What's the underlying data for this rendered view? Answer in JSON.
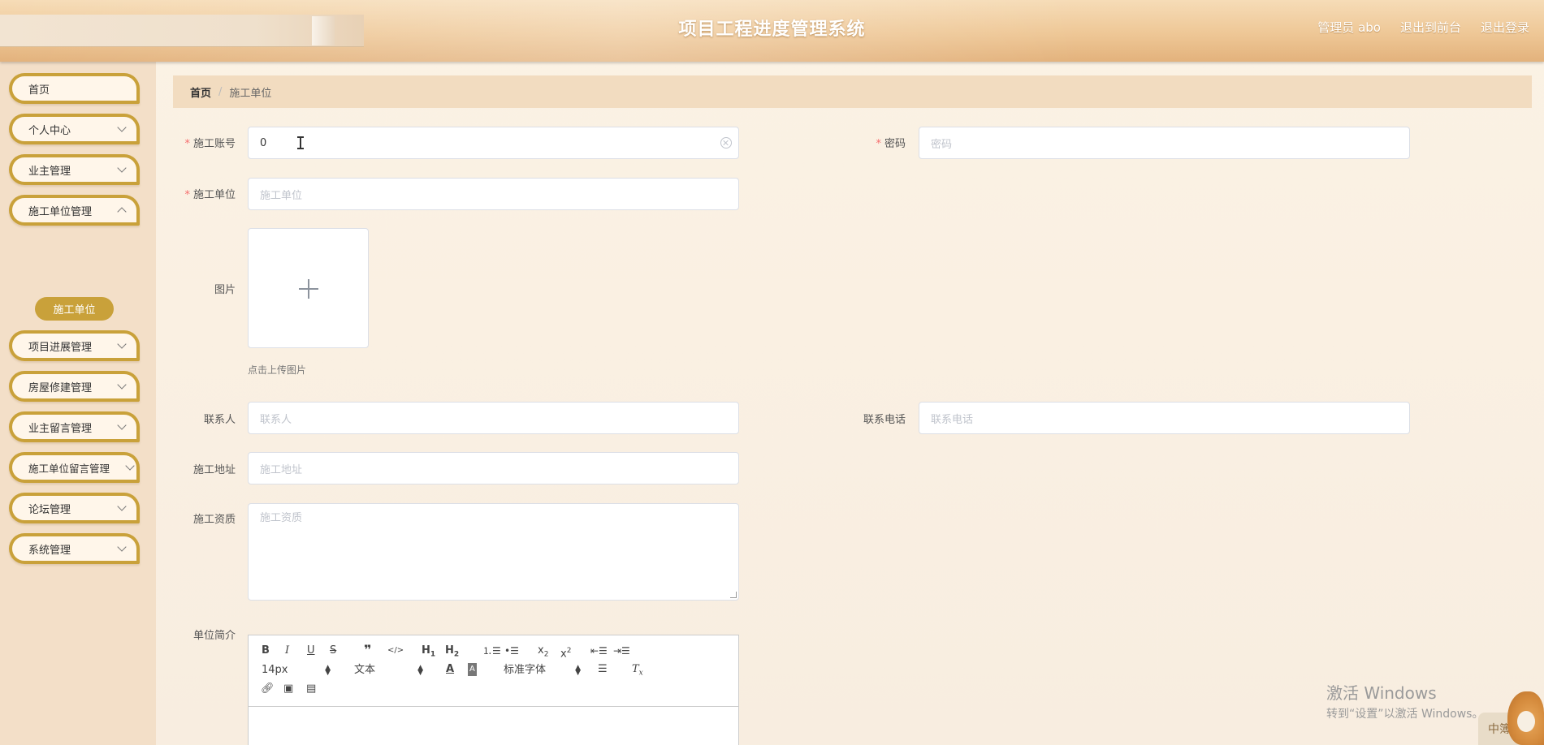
{
  "header": {
    "title": "项目工程进度管理系统",
    "links": [
      "管理员 abo",
      "退出到前台",
      "退出登录"
    ]
  },
  "sidebar": {
    "items": [
      {
        "label": "首页",
        "has_children": false
      },
      {
        "label": "个人中心",
        "has_children": true
      },
      {
        "label": "业主管理",
        "has_children": true
      },
      {
        "label": "施工单位管理",
        "has_children": true
      },
      {
        "label": "项目进展管理",
        "has_children": true
      },
      {
        "label": "房屋修建管理",
        "has_children": true
      },
      {
        "label": "业主留言管理",
        "has_children": true
      },
      {
        "label": "施工单位留言管理",
        "has_children": true
      },
      {
        "label": "论坛管理",
        "has_children": true
      },
      {
        "label": "系统管理",
        "has_children": true
      }
    ],
    "active_submenu": "施工单位"
  },
  "breadcrumb": {
    "home": "首页",
    "separator": "/",
    "current": "施工单位"
  },
  "form": {
    "account": {
      "label": "施工账号",
      "required": true,
      "value": "0",
      "placeholder": ""
    },
    "password": {
      "label": "密码",
      "required": true,
      "value": "",
      "placeholder": "密码"
    },
    "unit": {
      "label": "施工单位",
      "required": true,
      "value": "",
      "placeholder": "施工单位"
    },
    "image": {
      "label": "图片",
      "tip": "点击上传图片"
    },
    "contact": {
      "label": "联系人",
      "placeholder": "联系人"
    },
    "phone": {
      "label": "联系电话",
      "placeholder": "联系电话"
    },
    "address": {
      "label": "施工地址",
      "placeholder": "施工地址"
    },
    "qualification": {
      "label": "施工资质",
      "placeholder": "施工资质"
    },
    "intro": {
      "label": "单位简介"
    }
  },
  "editor": {
    "font_size": "14px",
    "paragraph": "文本",
    "font_family": "标准字体",
    "buttons_row1": [
      "B",
      "I",
      "U",
      "S",
      "❞",
      "</>",
      "H1",
      "H2",
      "ordered-list",
      "bullet-list",
      "x₂",
      "x²",
      "outdent",
      "indent"
    ],
    "buttons_row2": [
      "color",
      "background",
      "align",
      "clear-format"
    ],
    "buttons_row3": [
      "link",
      "image",
      "video"
    ]
  },
  "watermark": {
    "line1": "激活 Windows",
    "line2": "转到“设置”以激活 Windows。"
  },
  "corner_badge": "中簿"
}
